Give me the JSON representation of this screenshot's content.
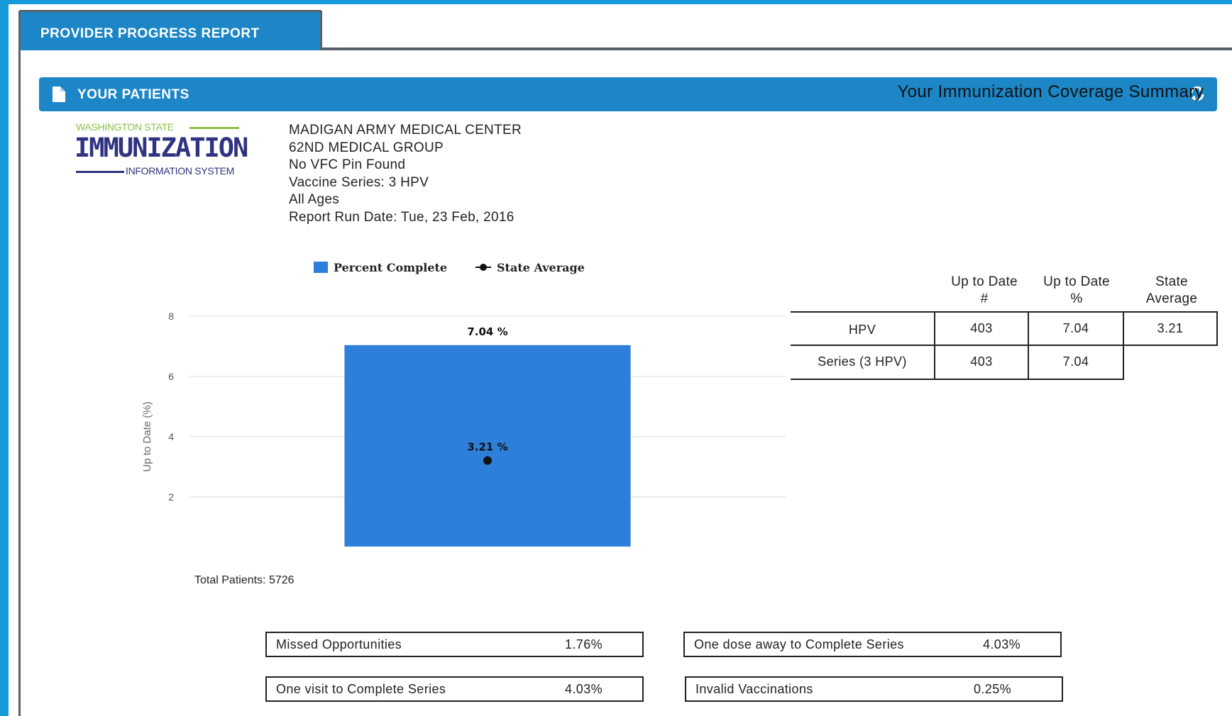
{
  "tab": {
    "label": "PROVIDER PROGRESS REPORT"
  },
  "panel": {
    "title": "YOUR PATIENTS",
    "icon": "document-icon",
    "action_icon": "refresh-icon"
  },
  "logo": {
    "top_text": "WASHINGTON STATE",
    "main_text": "IMMUNIZATION",
    "bottom_text": "INFORMATION SYSTEM",
    "colors": {
      "green": "#8cc04b",
      "navy": "#2f3380"
    }
  },
  "provider_info": [
    "MADIGAN ARMY MEDICAL CENTER",
    "62ND MEDICAL GROUP",
    "No VFC Pin Found",
    "Vaccine Series: 3 HPV",
    "All Ages",
    "Report Run Date: Tue, 23 Feb, 2016"
  ],
  "summary_title": "Your Immunization Coverage Summary",
  "chart_data": {
    "type": "bar",
    "categories": [
      "HPV"
    ],
    "series": [
      {
        "name": "Percent Complete",
        "values": [
          7.04
        ],
        "color": "#2e7fd9",
        "data_label": "7.04 %"
      },
      {
        "name": "State Average",
        "values": [
          3.21
        ],
        "color": "#111111",
        "marker": "dot",
        "data_label": "3.21 %"
      }
    ],
    "ylabel": "Up to Date (%)",
    "ylim": [
      0,
      8
    ],
    "yticks": [
      "0",
      "2",
      "4",
      "6",
      "8"
    ],
    "grid": true,
    "legend_position": "top"
  },
  "total_patients": "Total Patients: 5726",
  "coverage_table": {
    "headers": [
      "Up to Date\n#",
      "Up to Date\n%",
      "State\nAverage"
    ],
    "rows": [
      {
        "label": "HPV",
        "count": "403",
        "percent": "7.04",
        "state_avg": "3.21"
      },
      {
        "label": "Series (3 HPV)",
        "count": "403",
        "percent": "7.04",
        "state_avg": ""
      }
    ]
  },
  "stats": [
    {
      "label": "Missed Opportunities",
      "value": "1.76%"
    },
    {
      "label": "One dose away to Complete Series",
      "value": "4.03%"
    },
    {
      "label": "One visit to Complete Series",
      "value": "4.03%"
    },
    {
      "label": "Invalid Vaccinations",
      "value": "0.25%"
    }
  ],
  "colors": {
    "accent": "#1c86c6",
    "background": "#169ad9",
    "border": "#56626c"
  }
}
